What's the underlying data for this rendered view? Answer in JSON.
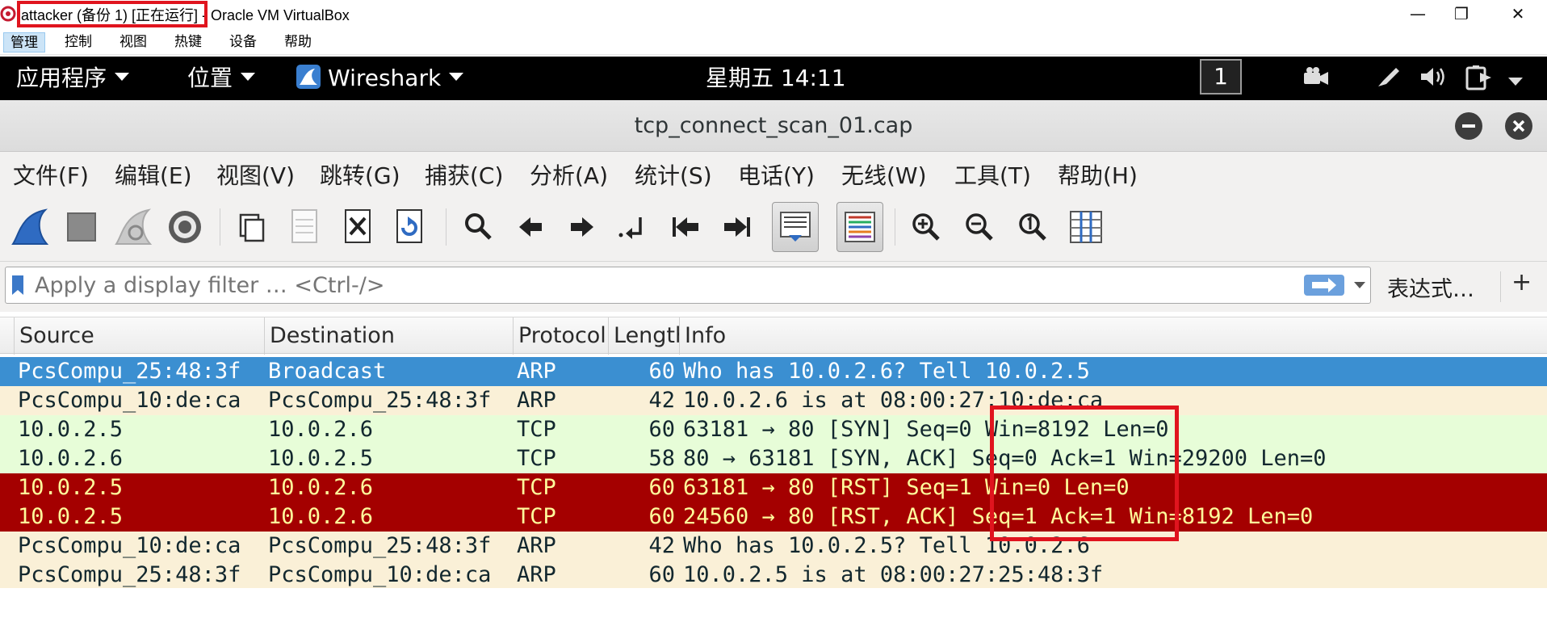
{
  "host_window": {
    "title": "attacker (备份 1) [正在运行] - Oracle VM VirtualBox",
    "controls": {
      "minimize": "—",
      "restore": "❐",
      "close": "✕"
    }
  },
  "vbox_menu": [
    {
      "label": "管理",
      "active": true
    },
    {
      "label": "控制"
    },
    {
      "label": "视图"
    },
    {
      "label": "热键"
    },
    {
      "label": "设备"
    },
    {
      "label": "帮助"
    }
  ],
  "gnome_bar": {
    "applications": "应用程序",
    "places": "位置",
    "app": "Wireshark",
    "clock": "星期五 14:11",
    "workspace": "1"
  },
  "wireshark": {
    "title": "tcp_connect_scan_01.cap",
    "menu": [
      "文件(F)",
      "编辑(E)",
      "视图(V)",
      "跳转(G)",
      "捕获(C)",
      "分析(A)",
      "统计(S)",
      "电话(Y)",
      "无线(W)",
      "工具(T)",
      "帮助(H)"
    ],
    "filter": {
      "placeholder": "Apply a display filter … <Ctrl-/>",
      "expression_label": "表达式…",
      "add_label": "+"
    },
    "columns": [
      "Source",
      "Destination",
      "Protocol",
      "Length",
      "Info"
    ],
    "packets": [
      {
        "source": "PcsCompu_25:48:3f",
        "destination": "Broadcast",
        "protocol": "ARP",
        "length": "60",
        "info": "Who has 10.0.2.6? Tell 10.0.2.5",
        "style": "selected"
      },
      {
        "source": "PcsCompu_10:de:ca",
        "destination": "PcsCompu_25:48:3f",
        "protocol": "ARP",
        "length": "42",
        "info": "10.0.2.6 is at 08:00:27:10:de:ca",
        "style": "arp"
      },
      {
        "source": "10.0.2.5",
        "destination": "10.0.2.6",
        "protocol": "TCP",
        "length": "60",
        "info": "63181 → 80 [SYN] Seq=0 Win=8192 Len=0",
        "style": "tcp"
      },
      {
        "source": "10.0.2.6",
        "destination": "10.0.2.5",
        "protocol": "TCP",
        "length": "58",
        "info": "80 → 63181 [SYN, ACK] Seq=0 Ack=1 Win=29200 Len=0",
        "style": "tcp"
      },
      {
        "source": "10.0.2.5",
        "destination": "10.0.2.6",
        "protocol": "TCP",
        "length": "60",
        "info": "63181 → 80 [RST] Seq=1 Win=0 Len=0",
        "style": "rst"
      },
      {
        "source": "10.0.2.5",
        "destination": "10.0.2.6",
        "protocol": "TCP",
        "length": "60",
        "info": "24560 → 80 [RST, ACK] Seq=1 Ack=1 Win=8192 Len=0",
        "style": "rst"
      },
      {
        "source": "PcsCompu_10:de:ca",
        "destination": "PcsCompu_25:48:3f",
        "protocol": "ARP",
        "length": "42",
        "info": "Who has 10.0.2.5? Tell 10.0.2.6",
        "style": "arp"
      },
      {
        "source": "PcsCompu_25:48:3f",
        "destination": "PcsCompu_10:de:ca",
        "protocol": "ARP",
        "length": "60",
        "info": "10.0.2.5 is at 08:00:27:25:48:3f",
        "style": "arp"
      }
    ]
  },
  "colors": {
    "selected_bg": "#3b8fd1",
    "selected_fg": "#ffffff",
    "arp_bg": "#faf0d7",
    "arp_fg": "#12272e",
    "tcp_bg": "#e7fdd8",
    "tcp_fg": "#12272e",
    "rst_bg": "#a40000",
    "rst_fg": "#fffc9c",
    "highlight": "#e0141e"
  }
}
